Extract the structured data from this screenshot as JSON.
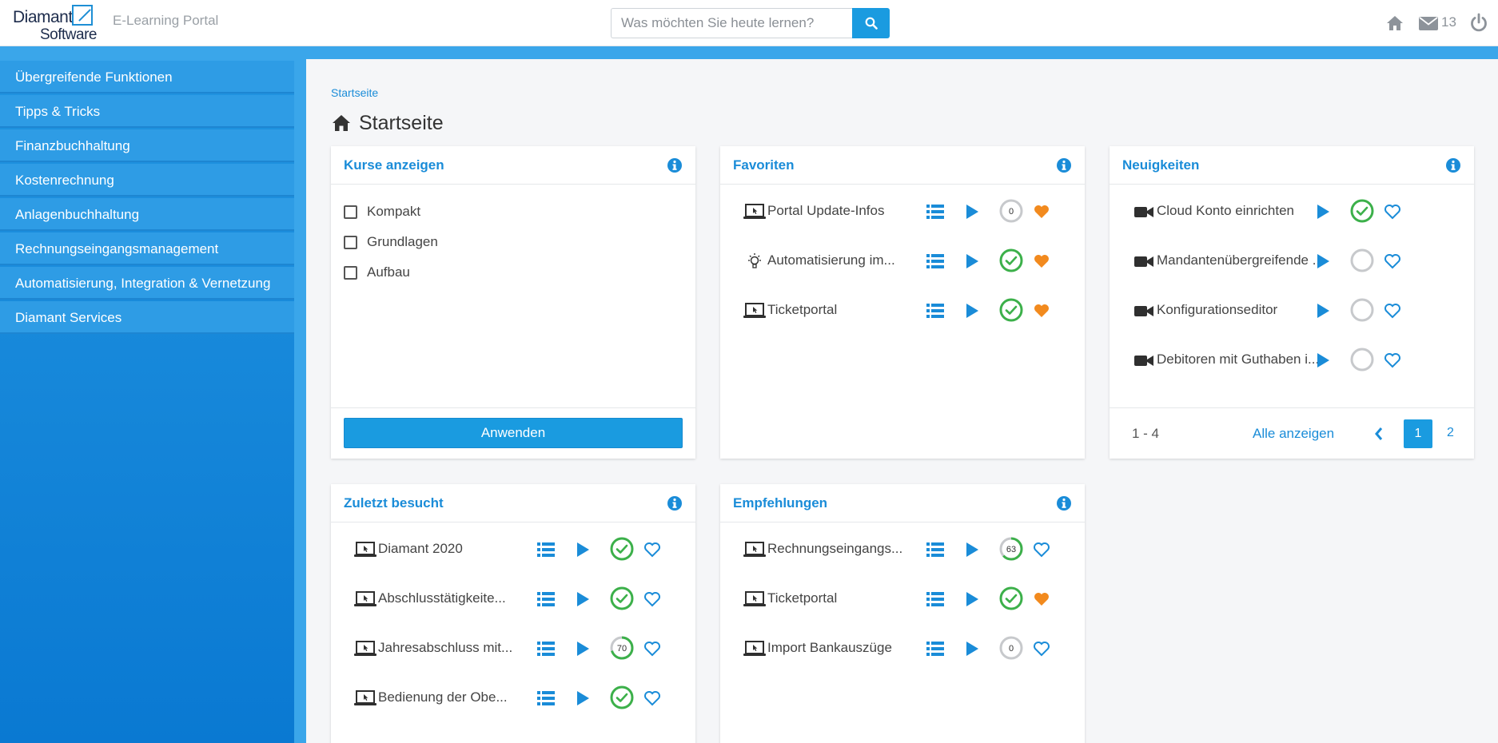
{
  "header": {
    "logo_line1": "Diamant",
    "logo_line2": "Software",
    "app_title": "E-Learning Portal",
    "search_placeholder": "Was möchten Sie heute lernen?",
    "mail_count": "13"
  },
  "sidebar": {
    "items": [
      {
        "label": "Übergreifende Funktionen"
      },
      {
        "label": "Tipps & Tricks"
      },
      {
        "label": "Finanzbuchhaltung"
      },
      {
        "label": "Kostenrechnung"
      },
      {
        "label": "Anlagenbuchhaltung"
      },
      {
        "label": "Rechnungseingangsmanagement"
      },
      {
        "label": "Automatisierung, Integration & Vernetzung"
      },
      {
        "label": "Diamant Services"
      }
    ]
  },
  "breadcrumb": "Startseite",
  "page_title": "Startseite",
  "kurse": {
    "title": "Kurse anzeigen",
    "options": [
      {
        "label": "Kompakt"
      },
      {
        "label": "Grundlagen"
      },
      {
        "label": "Aufbau"
      }
    ],
    "apply_label": "Anwenden"
  },
  "favoriten": {
    "title": "Favoriten",
    "items": [
      {
        "label": "Portal Update-Infos",
        "icon": "laptop-icon",
        "status": "progress",
        "progress": 0,
        "favorite": true
      },
      {
        "label": "Automatisierung im...",
        "icon": "lightbulb-icon",
        "status": "done",
        "favorite": true
      },
      {
        "label": "Ticketportal",
        "icon": "laptop-icon",
        "status": "done",
        "favorite": true
      }
    ]
  },
  "neuigkeiten": {
    "title": "Neuigkeiten",
    "items": [
      {
        "label": "Cloud Konto einrichten",
        "icon": "video-icon",
        "status": "done",
        "favorite": false
      },
      {
        "label": "Mandantenübergreifende ...",
        "icon": "video-icon",
        "status": "empty",
        "favorite": false
      },
      {
        "label": "Konfigurationseditor",
        "icon": "video-icon",
        "status": "empty",
        "favorite": false
      },
      {
        "label": "Debitoren mit Guthaben i...",
        "icon": "video-icon",
        "status": "empty",
        "favorite": false
      }
    ],
    "range": "1 - 4",
    "show_all": "Alle anzeigen",
    "page_current": "1",
    "page_next": "2"
  },
  "zuletzt": {
    "title": "Zuletzt besucht",
    "items": [
      {
        "label": "Diamant 2020",
        "icon": "laptop-icon",
        "status": "done",
        "favorite": false
      },
      {
        "label": "Abschlusstätigkeite...",
        "icon": "laptop-icon",
        "status": "done",
        "favorite": false
      },
      {
        "label": "Jahresabschluss mit...",
        "icon": "laptop-icon",
        "status": "progress",
        "progress": 70,
        "favorite": false
      },
      {
        "label": "Bedienung der Obe...",
        "icon": "laptop-icon",
        "status": "done",
        "favorite": false
      }
    ]
  },
  "empfehlungen": {
    "title": "Empfehlungen",
    "items": [
      {
        "label": "Rechnungseingangs...",
        "icon": "laptop-icon",
        "status": "progress",
        "progress": 63,
        "favorite": false
      },
      {
        "label": "Ticketportal",
        "icon": "laptop-icon",
        "status": "done",
        "favorite": true
      },
      {
        "label": "Import Bankauszüge",
        "icon": "laptop-icon",
        "status": "progress",
        "progress": 0,
        "favorite": false
      }
    ]
  },
  "colors": {
    "accent": "#1a9be0",
    "done_green": "#3cb04a",
    "heart_orange": "#f28a1e",
    "ring_gray": "#c7c9cc"
  }
}
